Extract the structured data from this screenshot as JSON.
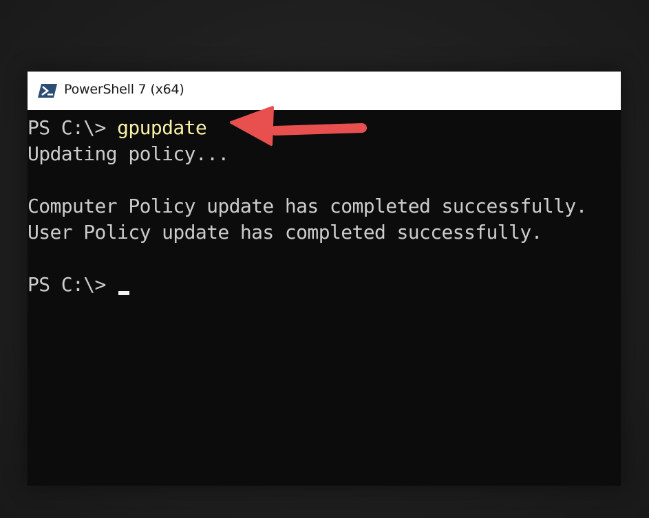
{
  "window": {
    "title": "PowerShell 7 (x64)",
    "icon": "powershell-icon"
  },
  "console": {
    "line1_prompt": "PS C:\\> ",
    "line1_command": "gpupdate",
    "line2": "Updating policy...",
    "line3": "Computer Policy update has completed successfully.",
    "line4": "User Policy update has completed successfully.",
    "line5_prompt": "PS C:\\> "
  },
  "annotation": {
    "type": "arrow",
    "color": "#e8504f",
    "points_to": "gpupdate"
  },
  "colors": {
    "console_bg": "#0c0c0c",
    "console_text": "#cccccc",
    "command_text": "#f9f1a5",
    "titlebar_bg": "#ffffff"
  }
}
